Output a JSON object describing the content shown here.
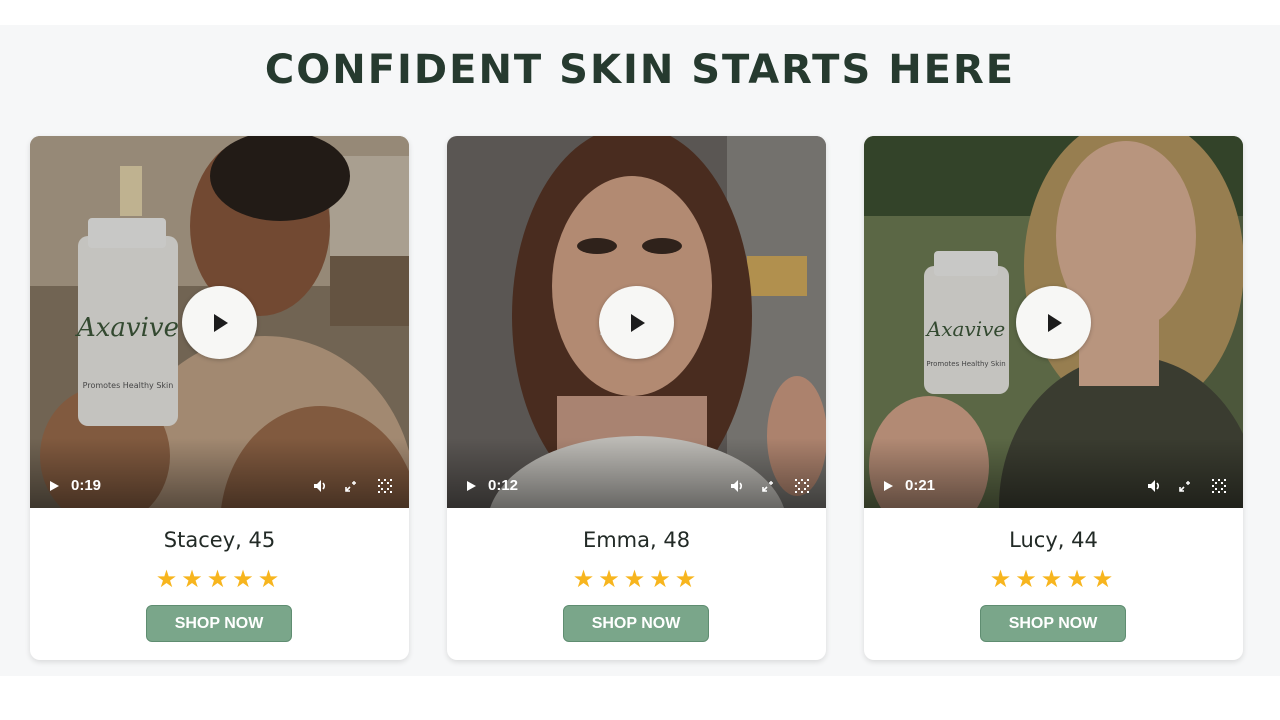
{
  "section": {
    "title": "CONFIDENT SKIN STARTS HERE"
  },
  "cards": [
    {
      "name": "Stacey, 45",
      "duration": "0:19",
      "rating": 5,
      "stars": "★★★★★",
      "button": "SHOP NOW",
      "product_label": "Axavive",
      "product_sub": "Promotes Healthy Skin"
    },
    {
      "name": "Emma, 48",
      "duration": "0:12",
      "rating": 5,
      "stars": "★★★★★",
      "button": "SHOP NOW"
    },
    {
      "name": "Lucy, 44",
      "duration": "0:21",
      "rating": 5,
      "stars": "★★★★★",
      "button": "SHOP NOW",
      "product_label": "Axavive",
      "product_sub": "Promotes Healthy Skin"
    }
  ],
  "colors": {
    "title": "#263a2f",
    "button": "#7aa68a",
    "star": "#f7b51e",
    "band": "#f6f7f8"
  },
  "icons": {
    "play": "play-icon",
    "volume": "volume-icon",
    "pip": "picture-in-picture-icon",
    "fullscreen": "fullscreen-icon"
  }
}
